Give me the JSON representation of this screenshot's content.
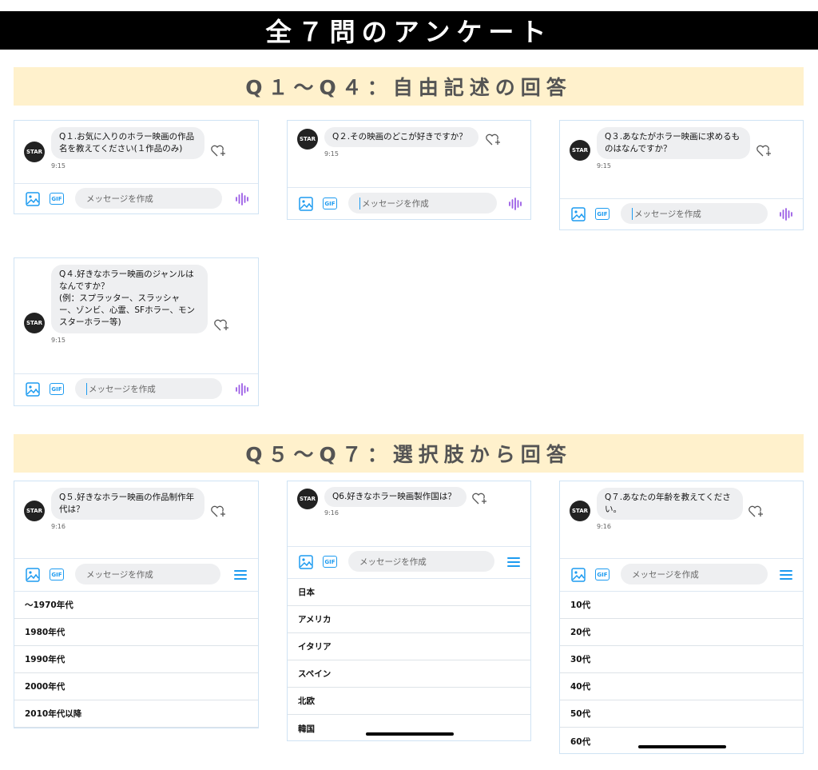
{
  "title": "全７問のアンケート",
  "section1": "Q１〜Q４：自由記述の回答",
  "section2": "Q５〜Q７：選択肢から回答",
  "avatar_label": "STAR",
  "composer_placeholder": "メッセージを作成",
  "gif_label": "GIF",
  "questions": [
    {
      "text": "Q１.お気に入りのホラー映画の作品\n名を教えてください(１作品のみ)",
      "time": "9:15"
    },
    {
      "text": "Q２.その映画のどこが好きですか？",
      "time": "9:15"
    },
    {
      "text": "Q３.あなたがホラー映画に求めるも\nのはなんですか？",
      "time": "9:15"
    },
    {
      "text": "Q４.好きなホラー映画のジャンルは\nなんですか？\n(例：スプラッター、スラッシャ\nー、ゾンビ、心霊、SFホラー、モン\nスターホラー等)",
      "time": "9:15"
    },
    {
      "text": "Q５.好きなホラー映画の作品制作年\n代は？",
      "time": "9:16",
      "options": [
        "〜1970年代",
        "1980年代",
        "1990年代",
        "2000年代",
        "2010年代以降"
      ]
    },
    {
      "text": "Q6.好きなホラー映画製作国は？",
      "time": "9:16",
      "options": [
        "日本",
        "アメリカ",
        "イタリア",
        "スペイン",
        "北欧",
        "韓国"
      ]
    },
    {
      "text": "Q７.あなたの年齢を教えてくださ\nい。",
      "time": "9:16",
      "options": [
        "10代",
        "20代",
        "30代",
        "40代",
        "50代",
        "60代"
      ]
    }
  ],
  "colors": {
    "accent": "#1d9bf0",
    "voice": "#9b5de5",
    "banner": "#fff1cc",
    "border": "#cfe3f4"
  }
}
